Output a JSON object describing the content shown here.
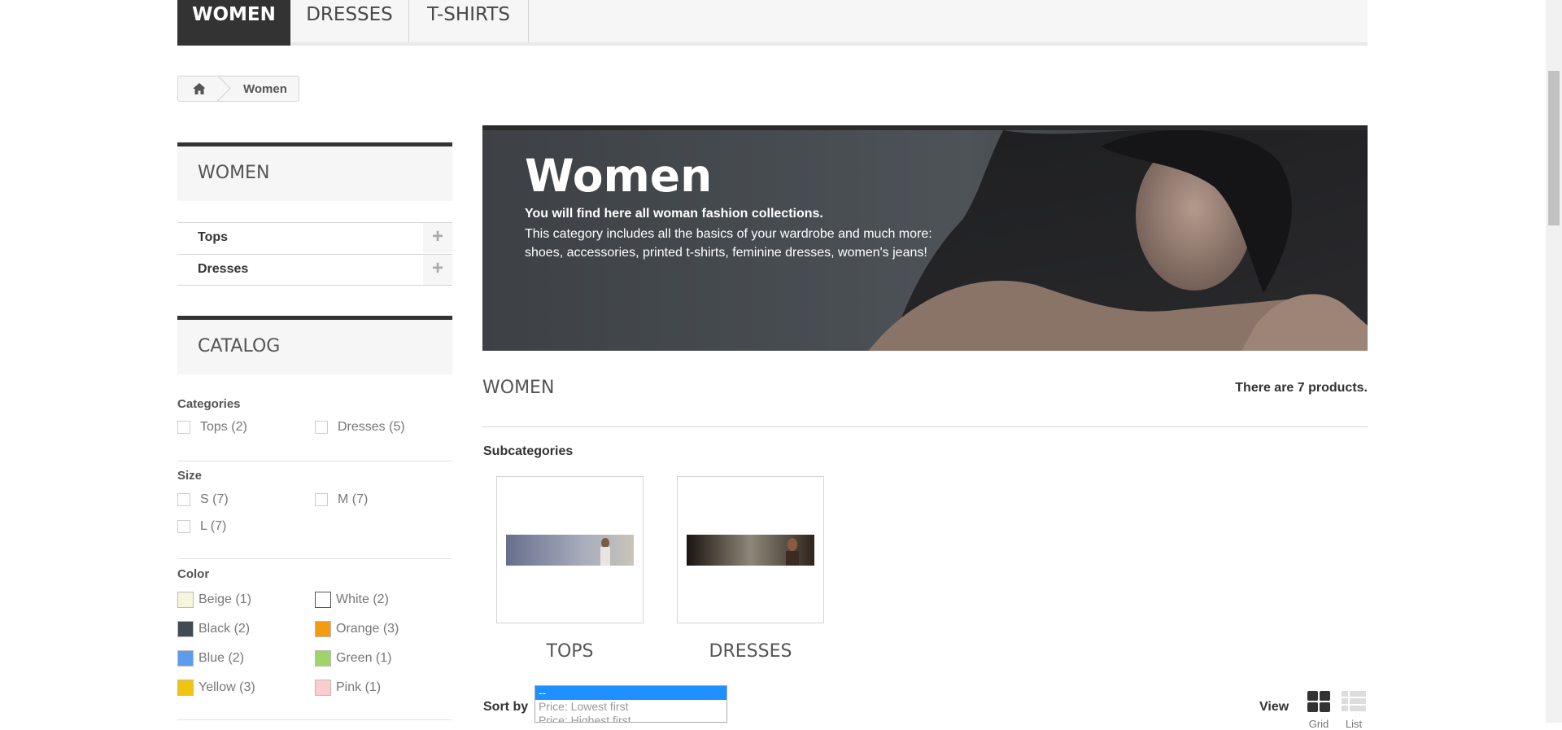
{
  "nav": {
    "tabs": [
      {
        "label": "WOMEN",
        "active": true
      },
      {
        "label": "DRESSES",
        "active": false
      },
      {
        "label": "T-SHIRTS",
        "active": false
      }
    ]
  },
  "breadcrumb": {
    "current": "Women"
  },
  "sidebar": {
    "women_title": "WOMEN",
    "categories": [
      {
        "label": "Tops"
      },
      {
        "label": "Dresses"
      }
    ],
    "catalog_title": "CATALOG",
    "filters": {
      "categories_title": "Categories",
      "categories": [
        "Tops (2)",
        "Dresses (5)"
      ],
      "size_title": "Size",
      "sizes": [
        "S (7)",
        "M (7)",
        "L (7)"
      ],
      "color_title": "Color",
      "colors": [
        {
          "label": "Beige (1)",
          "color": "#f5f5dc"
        },
        {
          "label": "White (2)",
          "color": "#ffffff"
        },
        {
          "label": "Black (2)",
          "color": "#434a54"
        },
        {
          "label": "Orange (3)",
          "color": "#f39c11"
        },
        {
          "label": "Blue (2)",
          "color": "#5d9cec"
        },
        {
          "label": "Green (1)",
          "color": "#a0d468"
        },
        {
          "label": "Yellow (3)",
          "color": "#f1c40f"
        },
        {
          "label": "Pink (1)",
          "color": "#fcccce"
        }
      ]
    }
  },
  "banner": {
    "title": "Women",
    "subtitle": "You will find here all woman fashion collections.",
    "description": "This category includes all the basics of your wardrobe and much more: shoes, accessories, printed t-shirts, feminine dresses, women's jeans!"
  },
  "content": {
    "heading": "WOMEN",
    "product_count": "There are 7 products.",
    "subcategories_title": "Subcategories",
    "subcategories": [
      {
        "name": "TOPS"
      },
      {
        "name": "DRESSES"
      }
    ]
  },
  "sort": {
    "label": "Sort by",
    "options": [
      "--",
      "Price: Lowest first",
      "Price: Highest first"
    ],
    "selected": "--"
  },
  "view": {
    "label": "View",
    "grid_label": "Grid",
    "list_label": "List"
  }
}
